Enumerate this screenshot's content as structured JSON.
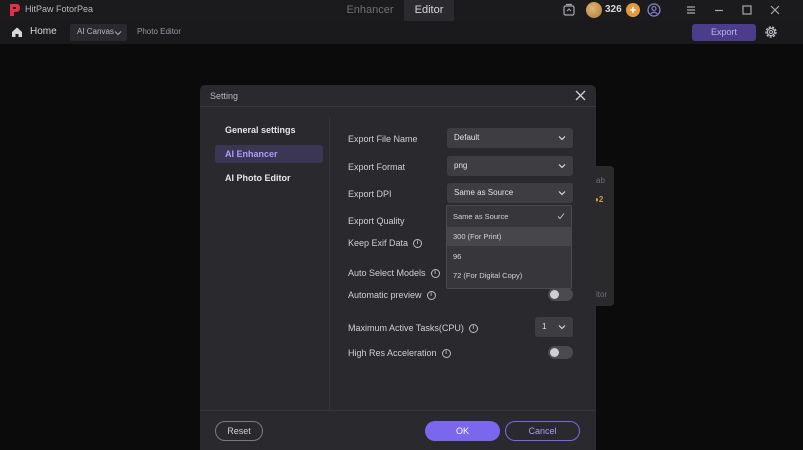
{
  "titlebar": {
    "app_name": "HitPaw FotorPea",
    "tabs": [
      {
        "label": "Enhancer"
      },
      {
        "label": "Editor"
      }
    ],
    "credits": "326"
  },
  "navbar": {
    "home_label": "Home",
    "ai_canvas_label": "AI Canvas",
    "photo_editor_label": "Photo Editor",
    "export_label": "Export"
  },
  "background": {
    "card_text_1": "ab",
    "card_text_2": "2",
    "card_text_3": "itor"
  },
  "dialog": {
    "title": "Setting",
    "sidebar": [
      {
        "label": "General settings"
      },
      {
        "label": "AI Enhancer"
      },
      {
        "label": "AI Photo Editor"
      }
    ],
    "fields": {
      "export_file_name": {
        "label": "Export File Name",
        "value": "Default"
      },
      "export_format": {
        "label": "Export Format",
        "value": "png"
      },
      "export_dpi": {
        "label": "Export DPI",
        "value": "Same as Source"
      },
      "export_quality": {
        "label": "Export Quality"
      },
      "keep_exif": {
        "label": "Keep Exif Data"
      },
      "auto_select_models": {
        "label": "Auto Select Models"
      },
      "automatic_preview": {
        "label": "Automatic preview"
      },
      "max_tasks": {
        "label": "Maximum Active Tasks(CPU)",
        "value": "1"
      },
      "high_res": {
        "label": "High Res Acceleration"
      }
    },
    "dpi_options": [
      {
        "label": "Same as Source"
      },
      {
        "label": "300 (For Print)"
      },
      {
        "label": "96"
      },
      {
        "label": "72 (For Digital Copy)"
      }
    ],
    "buttons": {
      "reset": "Reset",
      "ok": "OK",
      "cancel": "Cancel"
    }
  },
  "colors": {
    "accent": "#7b67ee",
    "export_button": "#4b3d8c",
    "coin_plus": "#e39a3d"
  }
}
